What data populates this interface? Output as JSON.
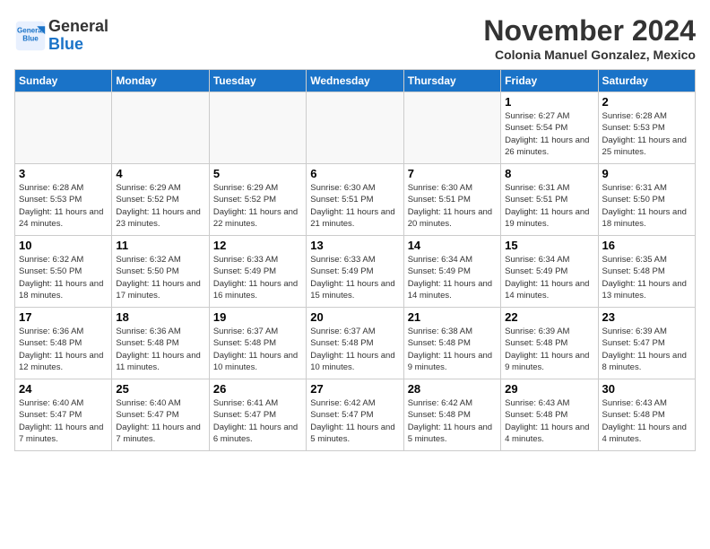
{
  "header": {
    "logo_line1": "General",
    "logo_line2": "Blue",
    "month": "November 2024",
    "location": "Colonia Manuel Gonzalez, Mexico"
  },
  "days_of_week": [
    "Sunday",
    "Monday",
    "Tuesday",
    "Wednesday",
    "Thursday",
    "Friday",
    "Saturday"
  ],
  "weeks": [
    [
      {
        "day": "",
        "info": ""
      },
      {
        "day": "",
        "info": ""
      },
      {
        "day": "",
        "info": ""
      },
      {
        "day": "",
        "info": ""
      },
      {
        "day": "",
        "info": ""
      },
      {
        "day": "1",
        "info": "Sunrise: 6:27 AM\nSunset: 5:54 PM\nDaylight: 11 hours and 26 minutes."
      },
      {
        "day": "2",
        "info": "Sunrise: 6:28 AM\nSunset: 5:53 PM\nDaylight: 11 hours and 25 minutes."
      }
    ],
    [
      {
        "day": "3",
        "info": "Sunrise: 6:28 AM\nSunset: 5:53 PM\nDaylight: 11 hours and 24 minutes."
      },
      {
        "day": "4",
        "info": "Sunrise: 6:29 AM\nSunset: 5:52 PM\nDaylight: 11 hours and 23 minutes."
      },
      {
        "day": "5",
        "info": "Sunrise: 6:29 AM\nSunset: 5:52 PM\nDaylight: 11 hours and 22 minutes."
      },
      {
        "day": "6",
        "info": "Sunrise: 6:30 AM\nSunset: 5:51 PM\nDaylight: 11 hours and 21 minutes."
      },
      {
        "day": "7",
        "info": "Sunrise: 6:30 AM\nSunset: 5:51 PM\nDaylight: 11 hours and 20 minutes."
      },
      {
        "day": "8",
        "info": "Sunrise: 6:31 AM\nSunset: 5:51 PM\nDaylight: 11 hours and 19 minutes."
      },
      {
        "day": "9",
        "info": "Sunrise: 6:31 AM\nSunset: 5:50 PM\nDaylight: 11 hours and 18 minutes."
      }
    ],
    [
      {
        "day": "10",
        "info": "Sunrise: 6:32 AM\nSunset: 5:50 PM\nDaylight: 11 hours and 18 minutes."
      },
      {
        "day": "11",
        "info": "Sunrise: 6:32 AM\nSunset: 5:50 PM\nDaylight: 11 hours and 17 minutes."
      },
      {
        "day": "12",
        "info": "Sunrise: 6:33 AM\nSunset: 5:49 PM\nDaylight: 11 hours and 16 minutes."
      },
      {
        "day": "13",
        "info": "Sunrise: 6:33 AM\nSunset: 5:49 PM\nDaylight: 11 hours and 15 minutes."
      },
      {
        "day": "14",
        "info": "Sunrise: 6:34 AM\nSunset: 5:49 PM\nDaylight: 11 hours and 14 minutes."
      },
      {
        "day": "15",
        "info": "Sunrise: 6:34 AM\nSunset: 5:49 PM\nDaylight: 11 hours and 14 minutes."
      },
      {
        "day": "16",
        "info": "Sunrise: 6:35 AM\nSunset: 5:48 PM\nDaylight: 11 hours and 13 minutes."
      }
    ],
    [
      {
        "day": "17",
        "info": "Sunrise: 6:36 AM\nSunset: 5:48 PM\nDaylight: 11 hours and 12 minutes."
      },
      {
        "day": "18",
        "info": "Sunrise: 6:36 AM\nSunset: 5:48 PM\nDaylight: 11 hours and 11 minutes."
      },
      {
        "day": "19",
        "info": "Sunrise: 6:37 AM\nSunset: 5:48 PM\nDaylight: 11 hours and 10 minutes."
      },
      {
        "day": "20",
        "info": "Sunrise: 6:37 AM\nSunset: 5:48 PM\nDaylight: 11 hours and 10 minutes."
      },
      {
        "day": "21",
        "info": "Sunrise: 6:38 AM\nSunset: 5:48 PM\nDaylight: 11 hours and 9 minutes."
      },
      {
        "day": "22",
        "info": "Sunrise: 6:39 AM\nSunset: 5:48 PM\nDaylight: 11 hours and 9 minutes."
      },
      {
        "day": "23",
        "info": "Sunrise: 6:39 AM\nSunset: 5:47 PM\nDaylight: 11 hours and 8 minutes."
      }
    ],
    [
      {
        "day": "24",
        "info": "Sunrise: 6:40 AM\nSunset: 5:47 PM\nDaylight: 11 hours and 7 minutes."
      },
      {
        "day": "25",
        "info": "Sunrise: 6:40 AM\nSunset: 5:47 PM\nDaylight: 11 hours and 7 minutes."
      },
      {
        "day": "26",
        "info": "Sunrise: 6:41 AM\nSunset: 5:47 PM\nDaylight: 11 hours and 6 minutes."
      },
      {
        "day": "27",
        "info": "Sunrise: 6:42 AM\nSunset: 5:47 PM\nDaylight: 11 hours and 5 minutes."
      },
      {
        "day": "28",
        "info": "Sunrise: 6:42 AM\nSunset: 5:48 PM\nDaylight: 11 hours and 5 minutes."
      },
      {
        "day": "29",
        "info": "Sunrise: 6:43 AM\nSunset: 5:48 PM\nDaylight: 11 hours and 4 minutes."
      },
      {
        "day": "30",
        "info": "Sunrise: 6:43 AM\nSunset: 5:48 PM\nDaylight: 11 hours and 4 minutes."
      }
    ]
  ]
}
